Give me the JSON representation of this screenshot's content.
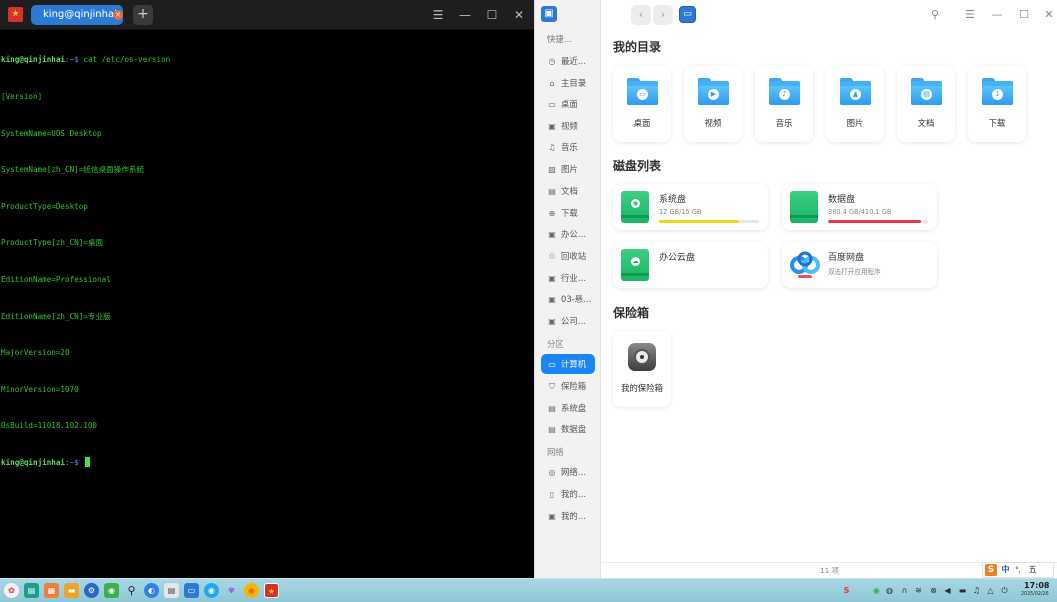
{
  "terminal": {
    "tab_label": "king@qinjinhai: ~",
    "add_tab": "+",
    "lines": [
      {
        "user": "king@qinjinhai",
        "path": ":~$ ",
        "cmd": "cat /etc/os-version"
      },
      {
        "text": "[Version]"
      },
      {
        "text": "SystemName=UOS Desktop"
      },
      {
        "text": "SystemName[zh_CN]=统信桌面操作系统"
      },
      {
        "text": "ProductType=Desktop"
      },
      {
        "text": "ProductType[zh_CN]=桌面"
      },
      {
        "text": "EditionName=Professional"
      },
      {
        "text": "EditionName[zh_CN]=专业版"
      },
      {
        "text": "MajorVersion=20"
      },
      {
        "text": "MinorVersion=1070"
      },
      {
        "text": "OsBuild=11018.102.100"
      },
      {
        "user": "king@qinjinhai",
        "path": ":~$ ",
        "cmd": ""
      }
    ]
  },
  "file_manager": {
    "sidebar": {
      "quick": [
        {
          "label": "快捷…",
          "icon": "none"
        },
        {
          "label": "最近…",
          "icon": "clock-icon"
        },
        {
          "label": "主目录",
          "icon": "home-icon"
        },
        {
          "label": "桌面",
          "icon": "desktop-icon"
        },
        {
          "label": "视频",
          "icon": "video-icon"
        },
        {
          "label": "音乐",
          "icon": "music-icon"
        },
        {
          "label": "图片",
          "icon": "picture-icon"
        },
        {
          "label": "文档",
          "icon": "document-icon"
        },
        {
          "label": "下载",
          "icon": "download-icon"
        },
        {
          "label": "办公…",
          "icon": "folder-icon"
        },
        {
          "label": "回收站",
          "icon": "trash-icon"
        },
        {
          "label": "行业…",
          "icon": "folder-icon"
        },
        {
          "label": "03-悬…",
          "icon": "folder-icon"
        },
        {
          "label": "公司…",
          "icon": "folder-icon"
        }
      ],
      "partition_header": "分区",
      "partition": [
        {
          "label": "计算机",
          "icon": "computer-icon",
          "active": true
        },
        {
          "label": "保险箱",
          "icon": "vault-icon"
        },
        {
          "label": "系统盘",
          "icon": "disk-icon"
        },
        {
          "label": "数据盘",
          "icon": "disk-icon"
        }
      ],
      "network_header": "网络",
      "network": [
        {
          "label": "网络…",
          "icon": "network-icon"
        },
        {
          "label": "我的…",
          "icon": "phone-icon"
        },
        {
          "label": "我的…",
          "icon": "folder-icon"
        }
      ]
    },
    "sections": {
      "my_dirs": "我的目录",
      "disks": "磁盘列表",
      "vault": "保险箱"
    },
    "dirs": [
      {
        "label": "桌面",
        "glyph": "desktop-icon"
      },
      {
        "label": "视频",
        "glyph": "play-icon"
      },
      {
        "label": "音乐",
        "glyph": "music-icon"
      },
      {
        "label": "图片",
        "glyph": "picture-icon"
      },
      {
        "label": "文档",
        "glyph": "document-icon"
      },
      {
        "label": "下载",
        "glyph": "download-icon"
      }
    ],
    "disks": [
      {
        "name": "系统盘",
        "size": "12 GB/15 GB",
        "usage": 0.8,
        "bar_color": "#f6d21a"
      },
      {
        "name": "数据盘",
        "size": "380.4 GB/410.1 GB",
        "usage": 0.93,
        "bar_color": "#e8364c"
      },
      {
        "name": "办公云盘",
        "size": "",
        "usage": null
      },
      {
        "name": "百度网盘",
        "size": "双击打开应用程序",
        "usage": null
      }
    ],
    "vault_item": "我的保险箱",
    "status": "11 项"
  },
  "ime": {
    "logo": "S",
    "lang": "中",
    "punct": "°,",
    "mode": "五",
    "settings": "⚙"
  },
  "taskbar": {
    "time": "17:08",
    "date": "2025/02/26"
  }
}
